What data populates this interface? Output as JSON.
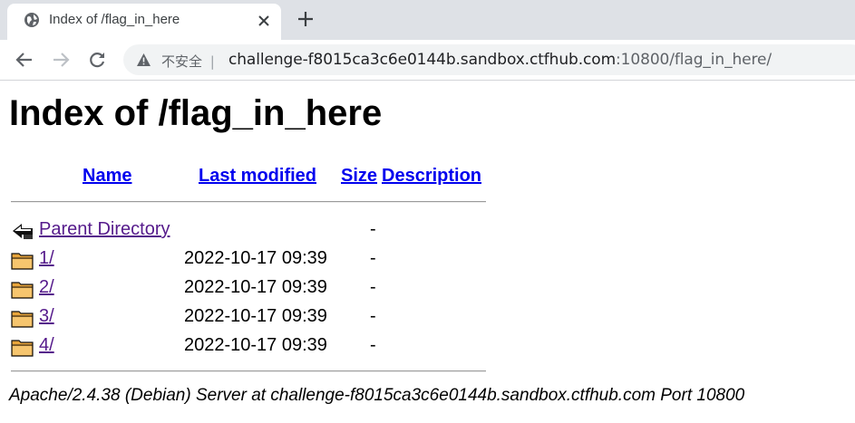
{
  "browser": {
    "tab_title": "Index of /flag_in_here",
    "insecure_label": "不安全",
    "separator": "|",
    "url_host": "challenge-f8015ca3c6e0144b.sandbox.ctfhub.com",
    "url_rest": ":10800/flag_in_here/"
  },
  "page": {
    "title": "Index of /flag_in_here",
    "columns": {
      "name": "Name",
      "last_modified": "Last modified",
      "size": "Size",
      "description": "Description"
    },
    "rows": [
      {
        "icon": "parent-directory-icon",
        "name": "Parent Directory",
        "date": "",
        "size": "-"
      },
      {
        "icon": "folder-icon",
        "name": "1/",
        "date": "2022-10-17 09:39",
        "size": "-"
      },
      {
        "icon": "folder-icon",
        "name": "2/",
        "date": "2022-10-17 09:39",
        "size": "-"
      },
      {
        "icon": "folder-icon",
        "name": "3/",
        "date": "2022-10-17 09:39",
        "size": "-"
      },
      {
        "icon": "folder-icon",
        "name": "4/",
        "date": "2022-10-17 09:39",
        "size": "-"
      }
    ],
    "address": "Apache/2.4.38 (Debian) Server at challenge-f8015ca3c6e0144b.sandbox.ctfhub.com Port 10800"
  }
}
